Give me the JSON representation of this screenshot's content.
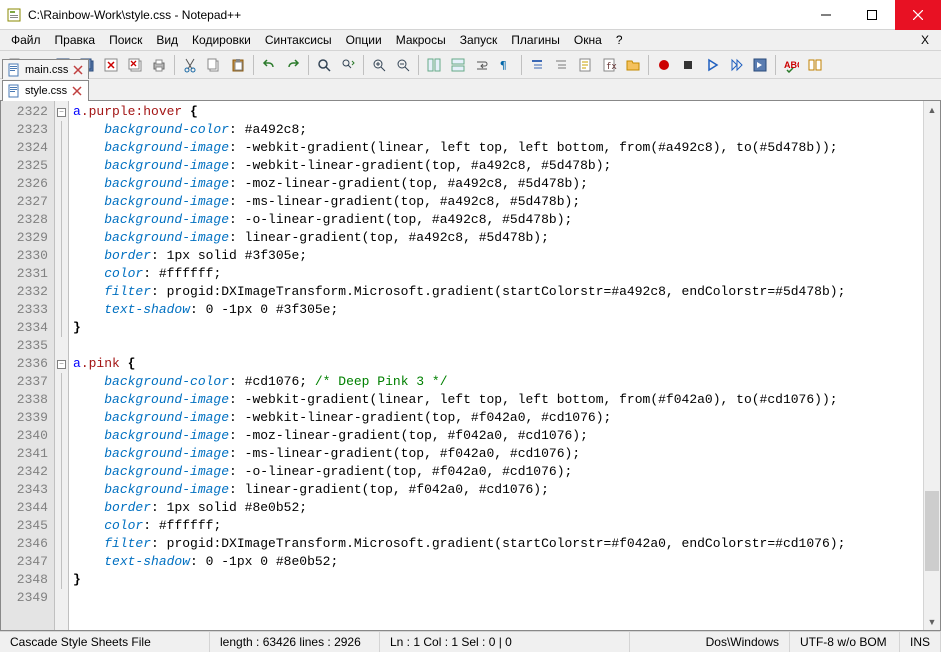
{
  "window": {
    "title": "C:\\Rainbow-Work\\style.css - Notepad++"
  },
  "menu": {
    "items": [
      "Файл",
      "Правка",
      "Поиск",
      "Вид",
      "Кодировки",
      "Синтаксисы",
      "Опции",
      "Макросы",
      "Запуск",
      "Плагины",
      "Окна",
      "?"
    ],
    "right": "X"
  },
  "tabs": {
    "items": [
      {
        "label": "main.css",
        "active": false
      },
      {
        "label": "style.css",
        "active": true
      }
    ]
  },
  "editor": {
    "first_line": 2322,
    "lines": [
      [
        [
          "sel",
          "a"
        ],
        [
          "cls",
          ".purple"
        ],
        [
          "cls",
          ":hover"
        ],
        [
          "punct",
          " "
        ],
        [
          "brace",
          "{"
        ]
      ],
      [
        [
          "pad",
          "    "
        ],
        [
          "prop",
          "background-color"
        ],
        [
          "punct",
          ": "
        ],
        [
          "val",
          "#a492c8"
        ],
        [
          "punct",
          ";"
        ]
      ],
      [
        [
          "pad",
          "    "
        ],
        [
          "prop",
          "background-image"
        ],
        [
          "punct",
          ": "
        ],
        [
          "val",
          "-webkit-gradient(linear, left top, left bottom, from(#a492c8), to(#5d478b))"
        ],
        [
          "punct",
          ";"
        ]
      ],
      [
        [
          "pad",
          "    "
        ],
        [
          "prop",
          "background-image"
        ],
        [
          "punct",
          ": "
        ],
        [
          "val",
          "-webkit-linear-gradient(top, #a492c8, #5d478b)"
        ],
        [
          "punct",
          ";"
        ]
      ],
      [
        [
          "pad",
          "    "
        ],
        [
          "prop",
          "background-image"
        ],
        [
          "punct",
          ": "
        ],
        [
          "val",
          "-moz-linear-gradient(top, #a492c8, #5d478b)"
        ],
        [
          "punct",
          ";"
        ]
      ],
      [
        [
          "pad",
          "    "
        ],
        [
          "prop",
          "background-image"
        ],
        [
          "punct",
          ": "
        ],
        [
          "val",
          "-ms-linear-gradient(top, #a492c8, #5d478b)"
        ],
        [
          "punct",
          ";"
        ]
      ],
      [
        [
          "pad",
          "    "
        ],
        [
          "prop",
          "background-image"
        ],
        [
          "punct",
          ": "
        ],
        [
          "val",
          "-o-linear-gradient(top, #a492c8, #5d478b)"
        ],
        [
          "punct",
          ";"
        ]
      ],
      [
        [
          "pad",
          "    "
        ],
        [
          "prop",
          "background-image"
        ],
        [
          "punct",
          ": "
        ],
        [
          "val",
          "linear-gradient(top, #a492c8, #5d478b)"
        ],
        [
          "punct",
          ";"
        ]
      ],
      [
        [
          "pad",
          "    "
        ],
        [
          "prop",
          "border"
        ],
        [
          "punct",
          ": "
        ],
        [
          "val",
          "1px solid #3f305e"
        ],
        [
          "punct",
          ";"
        ]
      ],
      [
        [
          "pad",
          "    "
        ],
        [
          "prop",
          "color"
        ],
        [
          "punct",
          ": "
        ],
        [
          "val",
          "#ffffff"
        ],
        [
          "punct",
          ";"
        ]
      ],
      [
        [
          "pad",
          "    "
        ],
        [
          "prop",
          "filter"
        ],
        [
          "punct",
          ": "
        ],
        [
          "val",
          "progid:DXImageTransform.Microsoft.gradient(startColorstr=#a492c8, endColorstr=#5d478b)"
        ],
        [
          "punct",
          ";"
        ]
      ],
      [
        [
          "pad",
          "    "
        ],
        [
          "prop",
          "text-shadow"
        ],
        [
          "punct",
          ": "
        ],
        [
          "val",
          "0 -1px 0 #3f305e"
        ],
        [
          "punct",
          ";"
        ]
      ],
      [
        [
          "brace",
          "}"
        ]
      ],
      [],
      [
        [
          "sel",
          "a"
        ],
        [
          "cls",
          ".pink"
        ],
        [
          "punct",
          " "
        ],
        [
          "brace",
          "{"
        ]
      ],
      [
        [
          "pad",
          "    "
        ],
        [
          "prop",
          "background-color"
        ],
        [
          "punct",
          ": "
        ],
        [
          "val",
          "#cd1076"
        ],
        [
          "punct",
          "; "
        ],
        [
          "cmt",
          "/* Deep Pink 3 */"
        ]
      ],
      [
        [
          "pad",
          "    "
        ],
        [
          "prop",
          "background-image"
        ],
        [
          "punct",
          ": "
        ],
        [
          "val",
          "-webkit-gradient(linear, left top, left bottom, from(#f042a0), to(#cd1076))"
        ],
        [
          "punct",
          ";"
        ]
      ],
      [
        [
          "pad",
          "    "
        ],
        [
          "prop",
          "background-image"
        ],
        [
          "punct",
          ": "
        ],
        [
          "val",
          "-webkit-linear-gradient(top, #f042a0, #cd1076)"
        ],
        [
          "punct",
          ";"
        ]
      ],
      [
        [
          "pad",
          "    "
        ],
        [
          "prop",
          "background-image"
        ],
        [
          "punct",
          ": "
        ],
        [
          "val",
          "-moz-linear-gradient(top, #f042a0, #cd1076)"
        ],
        [
          "punct",
          ";"
        ]
      ],
      [
        [
          "pad",
          "    "
        ],
        [
          "prop",
          "background-image"
        ],
        [
          "punct",
          ": "
        ],
        [
          "val",
          "-ms-linear-gradient(top, #f042a0, #cd1076)"
        ],
        [
          "punct",
          ";"
        ]
      ],
      [
        [
          "pad",
          "    "
        ],
        [
          "prop",
          "background-image"
        ],
        [
          "punct",
          ": "
        ],
        [
          "val",
          "-o-linear-gradient(top, #f042a0, #cd1076)"
        ],
        [
          "punct",
          ";"
        ]
      ],
      [
        [
          "pad",
          "    "
        ],
        [
          "prop",
          "background-image"
        ],
        [
          "punct",
          ": "
        ],
        [
          "val",
          "linear-gradient(top, #f042a0, #cd1076)"
        ],
        [
          "punct",
          ";"
        ]
      ],
      [
        [
          "pad",
          "    "
        ],
        [
          "prop",
          "border"
        ],
        [
          "punct",
          ": "
        ],
        [
          "val",
          "1px solid #8e0b52"
        ],
        [
          "punct",
          ";"
        ]
      ],
      [
        [
          "pad",
          "    "
        ],
        [
          "prop",
          "color"
        ],
        [
          "punct",
          ": "
        ],
        [
          "val",
          "#ffffff"
        ],
        [
          "punct",
          ";"
        ]
      ],
      [
        [
          "pad",
          "    "
        ],
        [
          "prop",
          "filter"
        ],
        [
          "punct",
          ": "
        ],
        [
          "val",
          "progid:DXImageTransform.Microsoft.gradient(startColorstr=#f042a0, endColorstr=#cd1076)"
        ],
        [
          "punct",
          ";"
        ]
      ],
      [
        [
          "pad",
          "    "
        ],
        [
          "prop",
          "text-shadow"
        ],
        [
          "punct",
          ": "
        ],
        [
          "val",
          "0 -1px 0 #8e0b52"
        ],
        [
          "punct",
          ";"
        ]
      ],
      [
        [
          "brace",
          "}"
        ]
      ],
      []
    ],
    "fold_rows": {
      "0": "minus",
      "14": "minus"
    }
  },
  "status": {
    "filetype": "Cascade Style Sheets File",
    "length_label": "length : 63426    lines : 2926",
    "pos_label": "Ln : 1    Col : 1    Sel : 0 | 0",
    "eol": "Dos\\Windows",
    "encoding": "UTF-8 w/o BOM",
    "ins": "INS"
  }
}
